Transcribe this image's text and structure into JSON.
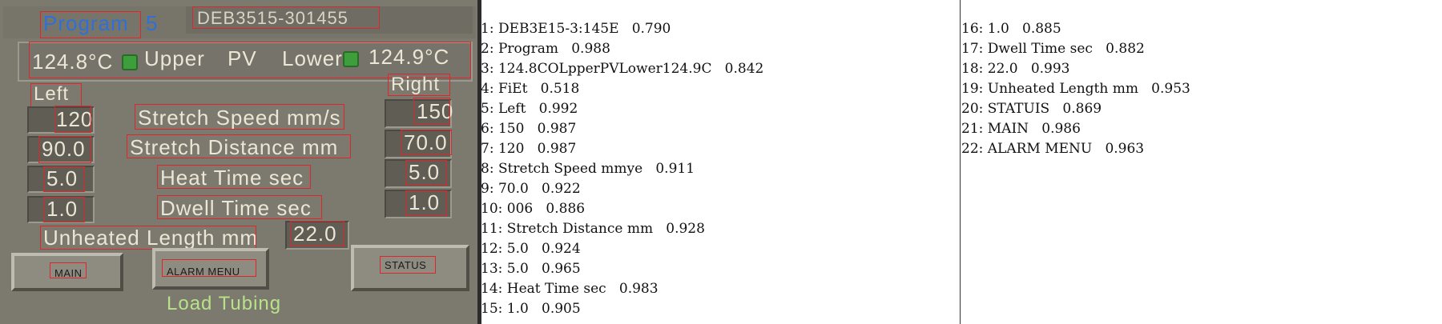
{
  "hmi": {
    "program_label": "Program",
    "program_number": "5",
    "device_id": "DEB3515-301455",
    "upper_pv": "124.8°C",
    "upper_label": "Upper",
    "pv_label": "PV",
    "lower_label": "Lower",
    "lower_pv": "124.9°C",
    "left_label": "Left",
    "right_label": "Right",
    "rows": [
      {
        "left": "120",
        "label": "Stretch Speed mm/s",
        "right": "150"
      },
      {
        "left": "90.0",
        "label": "Stretch Distance mm",
        "right": "70.0"
      },
      {
        "left": "5.0",
        "label": "Heat Time sec",
        "right": "5.0"
      },
      {
        "left": "1.0",
        "label": "Dwell Time sec",
        "right": "1.0"
      }
    ],
    "unheated_label": "Unheated Length mm",
    "unheated_value": "22.0",
    "buttons": {
      "main": "MAIN",
      "alarm_menu": "ALARM MENU",
      "status": "STATUS"
    },
    "status_text": "Load Tubing",
    "colors": {
      "led": "#3f9e3c",
      "box": "#e0262b",
      "program": "#2f6fd8",
      "status": "#b8e28a"
    }
  },
  "ocr": {
    "col1": [
      "1: DEB3E15-3:145E   0.790",
      "2: Program   0.988",
      "3: 124.8COLpperPVLower124.9C   0.842",
      "4: FiEt   0.518",
      "5: Left   0.992",
      "6: 150   0.987",
      "7: 120   0.987",
      "8: Stretch Speed mmye   0.911",
      "9: 70.0   0.922",
      "10: 006   0.886",
      "11: Stretch Distance mm   0.928",
      "12: 5.0   0.924",
      "13: 5.0   0.965",
      "14: Heat Time sec   0.983",
      "15: 1.0   0.905"
    ],
    "col2": [
      "16: 1.0   0.885",
      "17: Dwell Time sec   0.882",
      "18: 22.0   0.993",
      "19: Unheated Length mm   0.953",
      "20: STATUIS   0.869",
      "21: MAIN   0.986",
      "22: ALARM MENU   0.963"
    ]
  }
}
